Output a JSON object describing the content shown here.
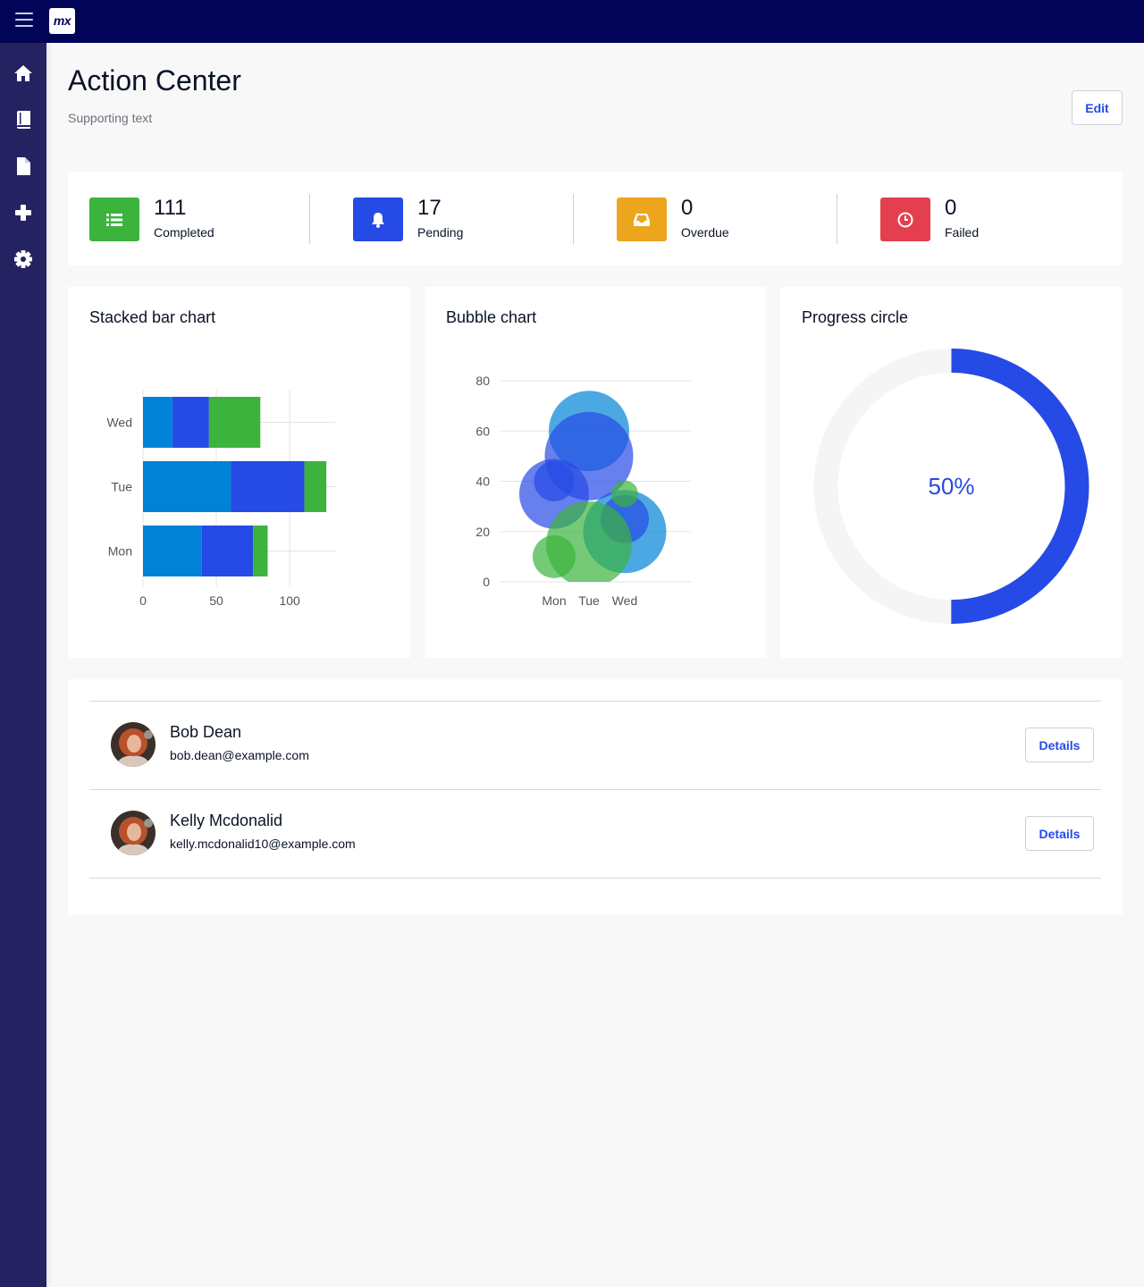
{
  "brand": {
    "logo_text": "mx"
  },
  "sidebar": {
    "items": [
      {
        "icon": "home-icon"
      },
      {
        "icon": "book-icon"
      },
      {
        "icon": "file-icon"
      },
      {
        "icon": "plus-icon"
      },
      {
        "icon": "gear-icon"
      }
    ]
  },
  "header": {
    "title": "Action Center",
    "subtitle": "Supporting text",
    "edit_label": "Edit"
  },
  "stats": [
    {
      "value": "111",
      "label": "Completed",
      "icon": "list-icon",
      "color": "#3cb33d"
    },
    {
      "value": "17",
      "label": "Pending",
      "icon": "bell-icon",
      "color": "#264ae5"
    },
    {
      "value": "0",
      "label": "Overdue",
      "icon": "inbox-icon",
      "color": "#eca51c"
    },
    {
      "value": "0",
      "label": "Failed",
      "icon": "clock-icon",
      "color": "#e33f4e"
    }
  ],
  "cards": {
    "bar_title": "Stacked bar chart",
    "bubble_title": "Bubble chart",
    "progress_title": "Progress circle"
  },
  "chart_data": [
    {
      "type": "bar",
      "orientation": "horizontal",
      "stacked": true,
      "title": "Stacked bar chart",
      "categories": [
        "Mon",
        "Tue",
        "Wed"
      ],
      "series": [
        {
          "values": [
            40,
            60,
            20
          ],
          "color": "#0083d6"
        },
        {
          "values": [
            35,
            50,
            25
          ],
          "color": "#264ae5"
        },
        {
          "values": [
            10,
            15,
            35
          ],
          "color": "#3cb33d"
        }
      ],
      "xlim": [
        0,
        131
      ],
      "xticks": [
        0,
        50,
        100
      ],
      "grid": true
    },
    {
      "type": "scatter",
      "subtype": "bubble",
      "title": "Bubble chart",
      "categories": [
        "Mon",
        "Tue",
        "Wed"
      ],
      "ylim": [
        0,
        80
      ],
      "yticks": [
        0,
        20,
        40,
        60,
        80
      ],
      "grid": true,
      "series": [
        {
          "color": "#0083d6",
          "points": [
            {
              "x": "Tue",
              "y": 60,
              "r": 30
            },
            {
              "x": "Wed",
              "y": 20,
              "r": 31
            }
          ]
        },
        {
          "color": "#264ae5",
          "points": [
            {
              "x": "Mon",
              "y": 40,
              "r": 15
            },
            {
              "x": "Tue",
              "y": 50,
              "r": 33
            },
            {
              "x": "Mon",
              "y": 35,
              "r": 26
            },
            {
              "x": "Wed",
              "y": 25,
              "r": 18
            }
          ]
        },
        {
          "color": "#3cb33d",
          "points": [
            {
              "x": "Mon",
              "y": 10,
              "r": 16
            },
            {
              "x": "Tue",
              "y": 15,
              "r": 32
            },
            {
              "x": "Wed",
              "y": 35,
              "r": 10
            }
          ]
        }
      ]
    }
  ],
  "progress": {
    "value": 50,
    "label": "50%",
    "color": "#264ae5",
    "track_color": "#f5f5f5"
  },
  "people": [
    {
      "name": "Bob Dean",
      "email": "bob.dean@example.com",
      "action": "Details"
    },
    {
      "name": "Kelly Mcdonalid",
      "email": "kelly.mcdonalid10@example.com",
      "action": "Details"
    }
  ]
}
